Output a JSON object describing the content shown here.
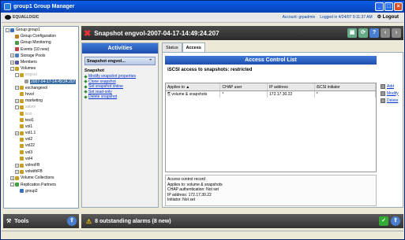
{
  "window": {
    "title": "group1 Group Manager"
  },
  "header": {
    "logo_text": "EQUALLOGIC",
    "account": "Account: grpadmin",
    "logged_in": "Logged in 4/24/07 9:11:37 AM",
    "logout": "Logout"
  },
  "tree": {
    "items": [
      {
        "label": "Group group1",
        "level": 0,
        "icon": "group-icon",
        "exp": "-"
      },
      {
        "label": "Group Configuration",
        "level": 1,
        "icon": "gear-icon",
        "exp": ""
      },
      {
        "label": "Group Monitoring",
        "level": 1,
        "icon": "monitor-icon",
        "exp": ""
      },
      {
        "label": "Events (10 new)",
        "level": 1,
        "icon": "events-icon",
        "exp": ""
      },
      {
        "label": "Storage Pools",
        "level": 1,
        "icon": "pool-icon",
        "exp": "+"
      },
      {
        "label": "Members",
        "level": 1,
        "icon": "members-icon",
        "exp": "+"
      },
      {
        "label": "Volumes",
        "level": 1,
        "icon": "volume-icon",
        "exp": "-"
      },
      {
        "label": "engvol",
        "level": 2,
        "icon": "volume-icon",
        "exp": "-",
        "dim": true
      },
      {
        "label": "2007-04-17-14:49:24.207",
        "level": 3,
        "icon": "snapshot-icon",
        "exp": "",
        "sel": true
      },
      {
        "label": "exchangevol",
        "level": 2,
        "icon": "volume-icon",
        "exp": "+"
      },
      {
        "label": "hrvol",
        "level": 2,
        "icon": "volume-icon",
        "exp": ""
      },
      {
        "label": "marketing",
        "level": 2,
        "icon": "volume-icon",
        "exp": "+"
      },
      {
        "label": "salvol",
        "level": 2,
        "icon": "volume-icon",
        "exp": "+",
        "dim": true
      },
      {
        "label": "test",
        "level": 2,
        "icon": "volume-icon",
        "exp": "",
        "dim": true
      },
      {
        "label": "test1",
        "level": 2,
        "icon": "volume-icon",
        "exp": ""
      },
      {
        "label": "vol1",
        "level": 2,
        "icon": "volume-icon",
        "exp": ""
      },
      {
        "label": "vol1.1",
        "level": 2,
        "icon": "volume-icon",
        "exp": "+"
      },
      {
        "label": "vol2",
        "level": 2,
        "icon": "volume-icon",
        "exp": ""
      },
      {
        "label": "vol22",
        "level": 2,
        "icon": "volume-icon",
        "exp": ""
      },
      {
        "label": "vol3",
        "level": 2,
        "icon": "volume-icon",
        "exp": ""
      },
      {
        "label": "vol4",
        "level": 2,
        "icon": "volume-icon",
        "exp": ""
      },
      {
        "label": "volnoFB",
        "level": 2,
        "icon": "volume-icon",
        "exp": "+"
      },
      {
        "label": "volwithFB",
        "level": 2,
        "icon": "volume-icon",
        "exp": "+"
      },
      {
        "label": "Volume Collections",
        "level": 1,
        "icon": "collection-icon",
        "exp": "+"
      },
      {
        "label": "Replication Partners",
        "level": 1,
        "icon": "replication-icon",
        "exp": "-"
      },
      {
        "label": "group2",
        "level": 2,
        "icon": "group-icon",
        "exp": ""
      }
    ]
  },
  "tools": {
    "label": "Tools"
  },
  "main": {
    "title": "Snapshot engvol-2007-04-17-14:49:24.207"
  },
  "activities": {
    "header": "Activities",
    "sub": "Snapshot engvol...",
    "section": "Snapshot",
    "links": [
      "Modify snapshot properties",
      "Clone snapshot",
      "Set snapshot online",
      "Set read-only",
      "Delete snapshot"
    ]
  },
  "tabs": [
    "Status",
    "Access"
  ],
  "acl": {
    "title": "Access Control List",
    "restricted": "iSCSI access to snapshots: restricted",
    "columns": [
      "Applies to",
      "CHAP user",
      "IP address",
      "iSCSI initiator"
    ],
    "rows": [
      [
        "volume & snapshots",
        "*",
        "172.17.30.22",
        "*"
      ]
    ],
    "actions": [
      "Add",
      "Modify",
      "Delete"
    ],
    "record": [
      "Access control record",
      "Applies to:  volume & snapshots",
      "CHAP authentication:  Not set",
      "IP address:  172.17.30.22",
      "Initiator:  Not set"
    ]
  },
  "alarm": {
    "text": "8 outstanding alarms (8 new)"
  }
}
